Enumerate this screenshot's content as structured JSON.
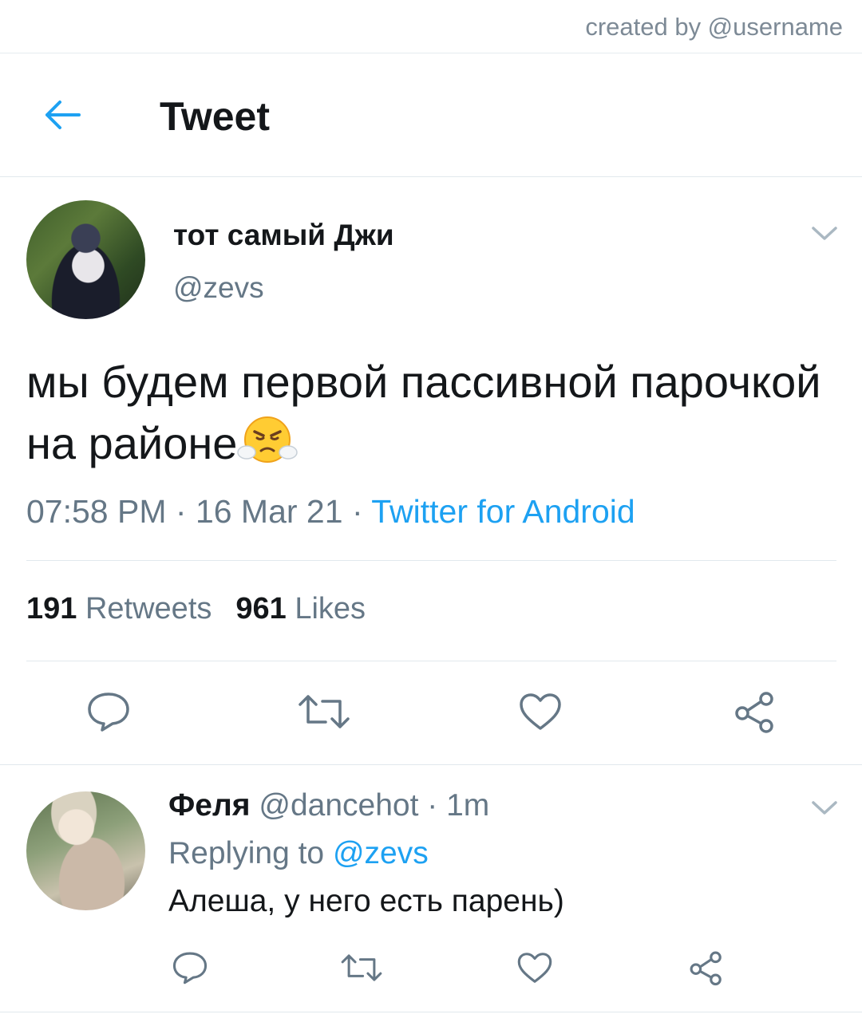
{
  "watermark": "created by @username",
  "header": {
    "title": "Tweet"
  },
  "tweet": {
    "display_name": "тот самый Джи",
    "handle": "@zevs",
    "text": "мы будем первой пассивной парочкой на районе",
    "emoji": "face-with-steam-from-nose",
    "time": "07:58 PM",
    "date": "16 Mar 21",
    "source": "Twitter for Android",
    "separator": " · ",
    "retweets_count": "191",
    "retweets_label": "Retweets",
    "likes_count": "961",
    "likes_label": "Likes"
  },
  "actions": [
    "reply-icon",
    "retweet-icon",
    "like-icon",
    "share-icon"
  ],
  "reply": {
    "display_name": "Феля",
    "handle": "@dancehot",
    "time": "1m",
    "separator": " · ",
    "replying_label": "Replying to",
    "replying_to": "@zevs",
    "text": "Алеша, у него есть парень)"
  },
  "colors": {
    "accent": "#1da1f2",
    "muted": "#657786",
    "text": "#14171a",
    "border": "#e1e8ed"
  }
}
